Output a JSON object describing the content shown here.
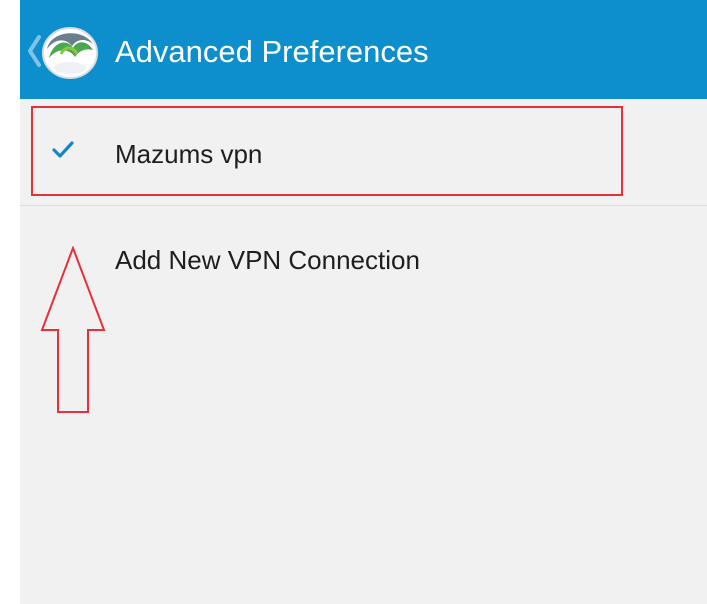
{
  "action_bar": {
    "title": "Advanced Preferences",
    "up_icon": "chevron-left-icon",
    "logo_icon": "anyconnect-globe-icon",
    "color": "#0d8fce"
  },
  "list": {
    "items": [
      {
        "label": "Mazums vpn",
        "selected": true,
        "icon": "check-icon"
      },
      {
        "label": "Add New VPN Connection",
        "selected": false
      }
    ]
  },
  "annotations": {
    "highlight_color": "#e8303b",
    "highlight_target": "Mazums vpn",
    "arrow_target": "Add New VPN Connection",
    "arrow_direction": "up"
  },
  "colors": {
    "background": "#f1f1f1",
    "check": "#1a84c7"
  }
}
